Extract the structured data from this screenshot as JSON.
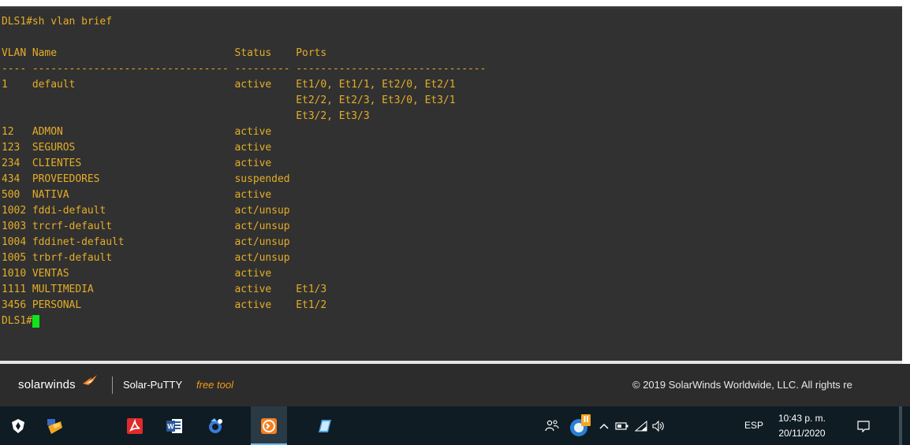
{
  "terminal": {
    "lines": [
      "DLS1#sh vlan brief",
      "",
      "VLAN Name                             Status    Ports",
      "---- -------------------------------- --------- -------------------------------",
      "1    default                          active    Et1/0, Et1/1, Et2/0, Et2/1",
      "                                                Et2/2, Et2/3, Et3/0, Et3/1",
      "                                                Et3/2, Et3/3",
      "12   ADMON                            active",
      "123  SEGUROS                          active",
      "234  CLIENTES                         active",
      "434  PROVEEDORES                      suspended",
      "500  NATIVA                           active",
      "1002 fddi-default                     act/unsup",
      "1003 trcrf-default                    act/unsup",
      "1004 fddinet-default                  act/unsup",
      "1005 trbrf-default                    act/unsup",
      "1010 VENTAS                           active",
      "1111 MULTIMEDIA                       active    Et1/3",
      "3456 PERSONAL                         active    Et1/2",
      "DLS1#"
    ],
    "text_color": "#e4ad27",
    "cursor_color": "#11e41a",
    "background": "#313131"
  },
  "brand_bar": {
    "logo_text": "solarwinds",
    "product": "Solar-PuTTY",
    "product_tag": "free tool",
    "copyright": "© 2019 SolarWinds Worldwide, LLC. All rights re"
  },
  "taskbar": {
    "apps": [
      "vpn-shield-icon",
      "sticky-app-icon",
      "pdf-reader-icon",
      "word-icon",
      "browser-icon",
      "solar-putty-icon",
      "notepad-icon"
    ],
    "tray": {
      "language": "ESP",
      "time": "10:43 p. m.",
      "date": "20/11/2020"
    }
  }
}
